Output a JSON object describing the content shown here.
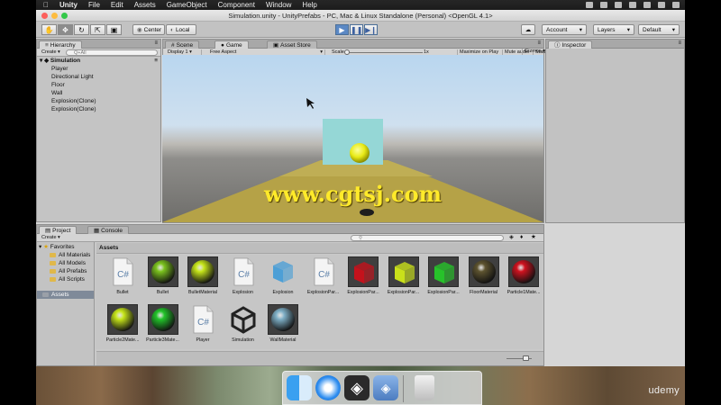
{
  "menubar": {
    "app_name": "Unity",
    "items": [
      "File",
      "Edit",
      "Assets",
      "GameObject",
      "Component",
      "Window",
      "Help"
    ]
  },
  "window": {
    "title": "Simulation.unity - UnityPrefabs - PC, Mac & Linux Standalone (Personal) <OpenGL 4.1>"
  },
  "toolbar": {
    "pivot_label": "Center",
    "space_label": "Local",
    "play_icon": "play-icon",
    "pause_icon": "pause-icon",
    "step_icon": "step-icon",
    "account_label": "Account",
    "layers_label": "Layers",
    "layout_label": "Default"
  },
  "hierarchy": {
    "tab_label": "Hierarchy",
    "create_label": "Create",
    "search_placeholder": "Q+All",
    "scene_name": "Simulation",
    "items": [
      "Player",
      "Directional Light",
      "Floor",
      "Wall",
      "Explosion(Clone)",
      "Explosion(Clone)"
    ]
  },
  "center_tabs": {
    "scene_label": "Scene",
    "game_label": "Game",
    "asset_store_label": "Asset Store"
  },
  "game_bar": {
    "display_label": "Display 1",
    "aspect_label": "Free Aspect",
    "scale_label": "Scale",
    "scale_value": "1x",
    "maximize_label": "Maximize on Play",
    "mute_label": "Mute audio",
    "stats_label": "Stats",
    "gizmos_label": "Gizmos"
  },
  "inspector": {
    "tab_label": "Inspector"
  },
  "overlay": {
    "watermark": "www.cgtsj.com"
  },
  "project": {
    "tab_label": "Project",
    "console_label": "Console",
    "create_label": "Create",
    "favorites_label": "Favorites",
    "favorites": [
      "All Materials",
      "All Models",
      "All Prefabs",
      "All Scripts"
    ],
    "assets_folder": "Assets",
    "breadcrumb": "Assets",
    "assets": [
      {
        "name": "Bullet",
        "kind": "script"
      },
      {
        "name": "Bullet",
        "kind": "sphere",
        "color": "#7bc21e"
      },
      {
        "name": "BulletMaterial",
        "kind": "sphere",
        "color": "#c7e61a"
      },
      {
        "name": "Explosion",
        "kind": "script"
      },
      {
        "name": "Explosion",
        "kind": "cube",
        "color": "#4d9fd6"
      },
      {
        "name": "ExplosionPar...",
        "kind": "script"
      },
      {
        "name": "ExplosionPar...",
        "kind": "cube",
        "color": "#c4121c"
      },
      {
        "name": "ExplosionPar...",
        "kind": "cube",
        "color": "#c9e01a"
      },
      {
        "name": "ExplosionPar...",
        "kind": "cube",
        "color": "#27c22a"
      },
      {
        "name": "FloorMaterial",
        "kind": "sphere",
        "color": "#5e5430"
      },
      {
        "name": "Particle1Mate...",
        "kind": "sphere",
        "color": "#d0121f"
      },
      {
        "name": "Particle2Mate...",
        "kind": "sphere",
        "color": "#c7e61a"
      },
      {
        "name": "Particle3Mate...",
        "kind": "sphere",
        "color": "#22c42a"
      },
      {
        "name": "Player",
        "kind": "script"
      },
      {
        "name": "Simulation",
        "kind": "unity"
      },
      {
        "name": "WallMaterial",
        "kind": "sphere",
        "color": "#7fb0c7"
      }
    ]
  },
  "dock": {
    "icons": [
      "finder-icon",
      "safari-icon",
      "unity-icon",
      "unity-monodevelop-icon",
      "trash-icon"
    ]
  },
  "brand": {
    "corner_text": "udemy"
  },
  "colors": {
    "play_active": "#5b88c4",
    "watermark": "#ffea2a"
  }
}
